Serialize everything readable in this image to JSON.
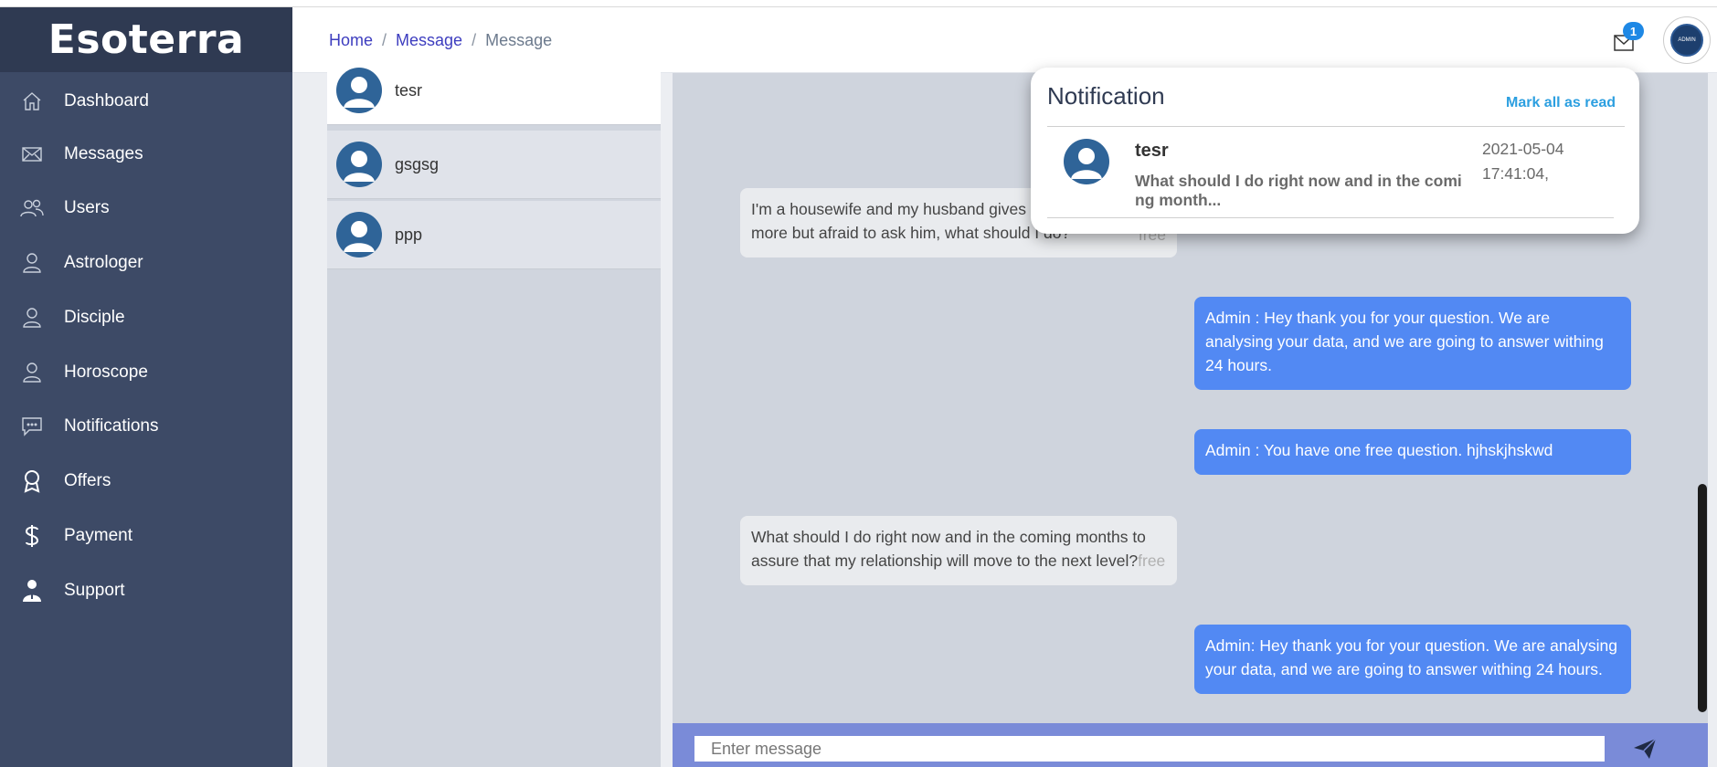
{
  "app": {
    "brand": "Esoterra"
  },
  "sidebar": {
    "items": [
      {
        "label": "Dashboard",
        "icon": "home-icon"
      },
      {
        "label": "Messages",
        "icon": "envelope-icon"
      },
      {
        "label": "Users",
        "icon": "users-icon"
      },
      {
        "label": "Astrologer",
        "icon": "user-icon"
      },
      {
        "label": "Disciple",
        "icon": "user-icon"
      },
      {
        "label": "Horoscope",
        "icon": "user-icon"
      },
      {
        "label": "Notifications",
        "icon": "chat-icon"
      },
      {
        "label": "Offers",
        "icon": "award-icon"
      },
      {
        "label": "Payment",
        "icon": "dollar-icon"
      },
      {
        "label": "Support",
        "icon": "support-person-icon"
      }
    ]
  },
  "header": {
    "breadcrumb": [
      {
        "label": "Home"
      },
      {
        "label": "Message"
      },
      {
        "label": "Message"
      }
    ],
    "separator": "/",
    "mail_badge": "1",
    "admin_avatar_text": "ADMIN"
  },
  "contacts": [
    {
      "name": "tesr"
    },
    {
      "name": "gsgsg"
    },
    {
      "name": "ppp"
    }
  ],
  "chat": {
    "messages": [
      {
        "direction": "in",
        "text": "I'm a housewife and my husband gives m",
        "text2": "more but afraid to ask him, what should I do?",
        "tag": "free"
      },
      {
        "direction": "out",
        "text": "Admin : Hey thank you for your question. We are analysing your data, and we are going to answer withing 24 hours."
      },
      {
        "direction": "out",
        "text": "Admin : You have one free question. hjhskjhskwd"
      },
      {
        "direction": "in",
        "text": "What should I do right now and in the coming months to assure that my relationship will move to the next level?",
        "tag": "free"
      },
      {
        "direction": "out",
        "text": "Admin: Hey thank you for your question. We are analysing your data, and we are going to answer withing 24 hours."
      }
    ],
    "input_placeholder": "Enter message"
  },
  "notification": {
    "title": "Notification",
    "mark_all_label": "Mark all as read",
    "items": [
      {
        "name": "tesr",
        "text": "What should I do right now and in the comi ng month...",
        "date": "2021-05-04",
        "time": "17:41:04,"
      }
    ]
  },
  "colors": {
    "sidebar_bg": "#3d4a66",
    "brand_bg": "#2f3a52",
    "outgoing_bubble": "#5289f3",
    "input_bar": "#7a8bd8",
    "badge": "#1e88e5",
    "mark_read": "#2c9fe0"
  }
}
